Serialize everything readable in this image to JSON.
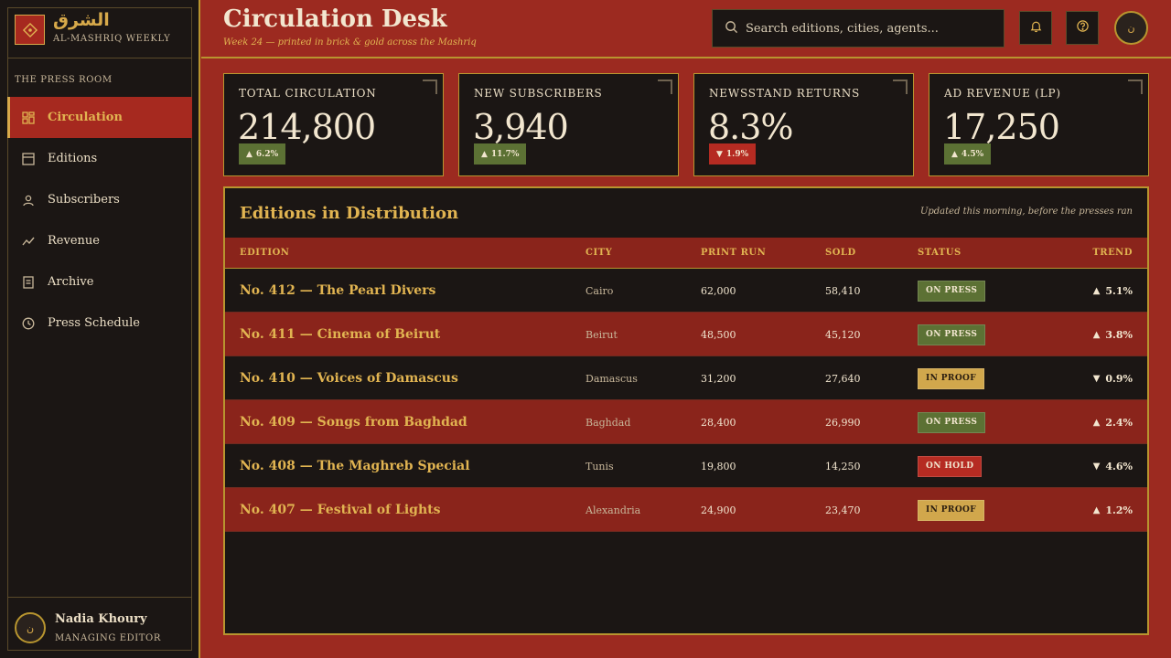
{
  "brand": {
    "name": "الشرق",
    "subtitle": "AL-MASHRIQ WEEKLY",
    "icon": "diamond-icon"
  },
  "sidebar": {
    "section_label": "THE PRESS ROOM",
    "items": [
      {
        "label": "Circulation",
        "icon": "grid-icon",
        "active": true
      },
      {
        "label": "Editions",
        "icon": "layout-icon",
        "active": false
      },
      {
        "label": "Subscribers",
        "icon": "user-icon",
        "active": false
      },
      {
        "label": "Revenue",
        "icon": "trend-icon",
        "active": false
      },
      {
        "label": "Archive",
        "icon": "document-icon",
        "active": false
      },
      {
        "label": "Press Schedule",
        "icon": "clock-icon",
        "active": false
      }
    ],
    "profile": {
      "name": "Nadia Khoury",
      "role": "MANAGING EDITOR",
      "initial": "ن"
    }
  },
  "header": {
    "title": "Circulation Desk",
    "subtitle": "Week 24 — printed in brick & gold across the Mashriq",
    "search_placeholder": "Search editions, cities, agents...",
    "avatar_initial": "ن"
  },
  "stats": [
    {
      "label": "TOTAL CIRCULATION",
      "value": "214,800",
      "change": "6.2%",
      "direction": "up"
    },
    {
      "label": "NEW SUBSCRIBERS",
      "value": "3,940",
      "change": "11.7%",
      "direction": "up"
    },
    {
      "label": "NEWSSTAND RETURNS",
      "value": "8.3%",
      "change": "1.9%",
      "direction": "down"
    },
    {
      "label": "AD REVENUE (LP)",
      "value": "17,250",
      "change": "4.5%",
      "direction": "up"
    }
  ],
  "table": {
    "title": "Editions in Distribution",
    "note": "Updated this morning, before the presses ran",
    "columns": [
      "EDITION",
      "CITY",
      "PRINT RUN",
      "SOLD",
      "STATUS",
      "TREND"
    ],
    "rows": [
      {
        "edition": "No. 412 — The Pearl Divers",
        "city": "Cairo",
        "print_run": "62,000",
        "sold": "58,410",
        "status": "ON PRESS",
        "trend": "5.1%",
        "direction": "up"
      },
      {
        "edition": "No. 411 — Cinema of Beirut",
        "city": "Beirut",
        "print_run": "48,500",
        "sold": "45,120",
        "status": "ON PRESS",
        "trend": "3.8%",
        "direction": "up"
      },
      {
        "edition": "No. 410 — Voices of Damascus",
        "city": "Damascus",
        "print_run": "31,200",
        "sold": "27,640",
        "status": "IN PROOF",
        "trend": "0.9%",
        "direction": "down"
      },
      {
        "edition": "No. 409 — Songs from Baghdad",
        "city": "Baghdad",
        "print_run": "28,400",
        "sold": "26,990",
        "status": "ON PRESS",
        "trend": "2.4%",
        "direction": "up"
      },
      {
        "edition": "No. 408 — The Maghreb Special",
        "city": "Tunis",
        "print_run": "19,800",
        "sold": "14,250",
        "status": "ON HOLD",
        "trend": "4.6%",
        "direction": "down"
      },
      {
        "edition": "No. 407 — Festival of Lights",
        "city": "Alexandria",
        "print_run": "24,900",
        "sold": "23,470",
        "status": "IN PROOF",
        "trend": "1.2%",
        "direction": "up"
      }
    ]
  },
  "colors": {
    "brick": "#9c2a20",
    "gold": "#d7a94a",
    "ink": "#1b1614",
    "olive": "#5c7134"
  }
}
